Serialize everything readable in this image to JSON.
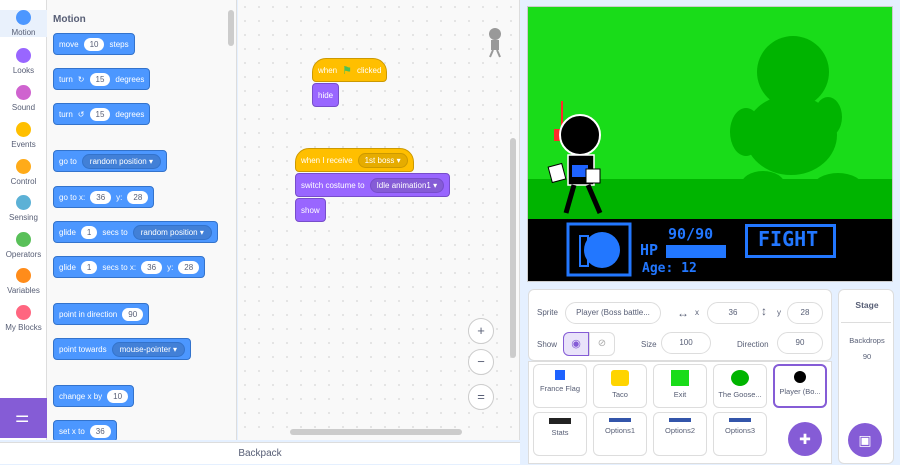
{
  "categories": [
    {
      "label": "Motion",
      "color": "#4c97ff"
    },
    {
      "label": "Looks",
      "color": "#9966ff"
    },
    {
      "label": "Sound",
      "color": "#cf63cf"
    },
    {
      "label": "Events",
      "color": "#ffbf00"
    },
    {
      "label": "Control",
      "color": "#ffab19"
    },
    {
      "label": "Sensing",
      "color": "#5cb1d6"
    },
    {
      "label": "Operators",
      "color": "#59c059"
    },
    {
      "label": "Variables",
      "color": "#ff8c1a"
    },
    {
      "label": "My Blocks",
      "color": "#ff6680"
    }
  ],
  "palette": {
    "title": "Motion",
    "move": {
      "pre": "move",
      "val": "10",
      "post": "steps"
    },
    "turn_right": {
      "pre": "turn",
      "val": "15",
      "post": "degrees"
    },
    "turn_left": {
      "pre": "turn",
      "val": "15",
      "post": "degrees"
    },
    "goto": {
      "pre": "go to",
      "drop": "random position"
    },
    "goto_xy": {
      "pre": "go to x:",
      "x": "36",
      "mid": "y:",
      "y": "28"
    },
    "glide_to": {
      "pre": "glide",
      "val": "1",
      "mid": "secs to",
      "drop": "random position"
    },
    "glide_xy": {
      "pre": "glide",
      "val": "1",
      "mid": "secs to x:",
      "x": "36",
      "mid2": "y:",
      "y": "28"
    },
    "point_dir": {
      "pre": "point in direction",
      "val": "90"
    },
    "point_towards": {
      "pre": "point towards",
      "drop": "mouse-pointer"
    },
    "change_x": {
      "pre": "change x by",
      "val": "10"
    },
    "set_x": {
      "pre": "set x to",
      "val": "36"
    }
  },
  "scripts": {
    "when_flag": {
      "pre": "when",
      "post": "clicked"
    },
    "hide": "hide",
    "when_receive": {
      "pre": "when I receive",
      "drop": "1st boss"
    },
    "switch_costume": {
      "pre": "switch costume to",
      "drop": "Idle animation1"
    },
    "show": "show"
  },
  "zoom": {
    "in": "+",
    "out": "−",
    "reset": "="
  },
  "backpack": "Backpack",
  "stage": {
    "hp_value": "90/90",
    "hp_label": "HP",
    "age_label": "Age: 12",
    "fight": "FIGHT"
  },
  "sprite_info": {
    "sprite_label": "Sprite",
    "sprite_name": "Player (Boss battle...",
    "x_label": "x",
    "x": "36",
    "y_label": "y",
    "y": "28",
    "show_label": "Show",
    "size_label": "Size",
    "size": "100",
    "direction_label": "Direction",
    "direction": "90"
  },
  "sprites": [
    {
      "name": "France Flag",
      "color": "#1e63ff"
    },
    {
      "name": "Taco",
      "color": "#ffd400"
    },
    {
      "name": "Exit",
      "color": "#19dc19"
    },
    {
      "name": "The Goose...",
      "color": "#00b400"
    },
    {
      "name": "Player (Bo...",
      "color": "#000000",
      "selected": true
    },
    {
      "name": "Stats",
      "color": "#222222"
    },
    {
      "name": "Options1",
      "color": "#3355aa"
    },
    {
      "name": "Options2",
      "color": "#3355aa"
    },
    {
      "name": "Options3",
      "color": "#3355aa"
    }
  ],
  "stage_panel": {
    "title": "Stage",
    "backdrops_label": "Backdrops",
    "backdrops": "90"
  }
}
